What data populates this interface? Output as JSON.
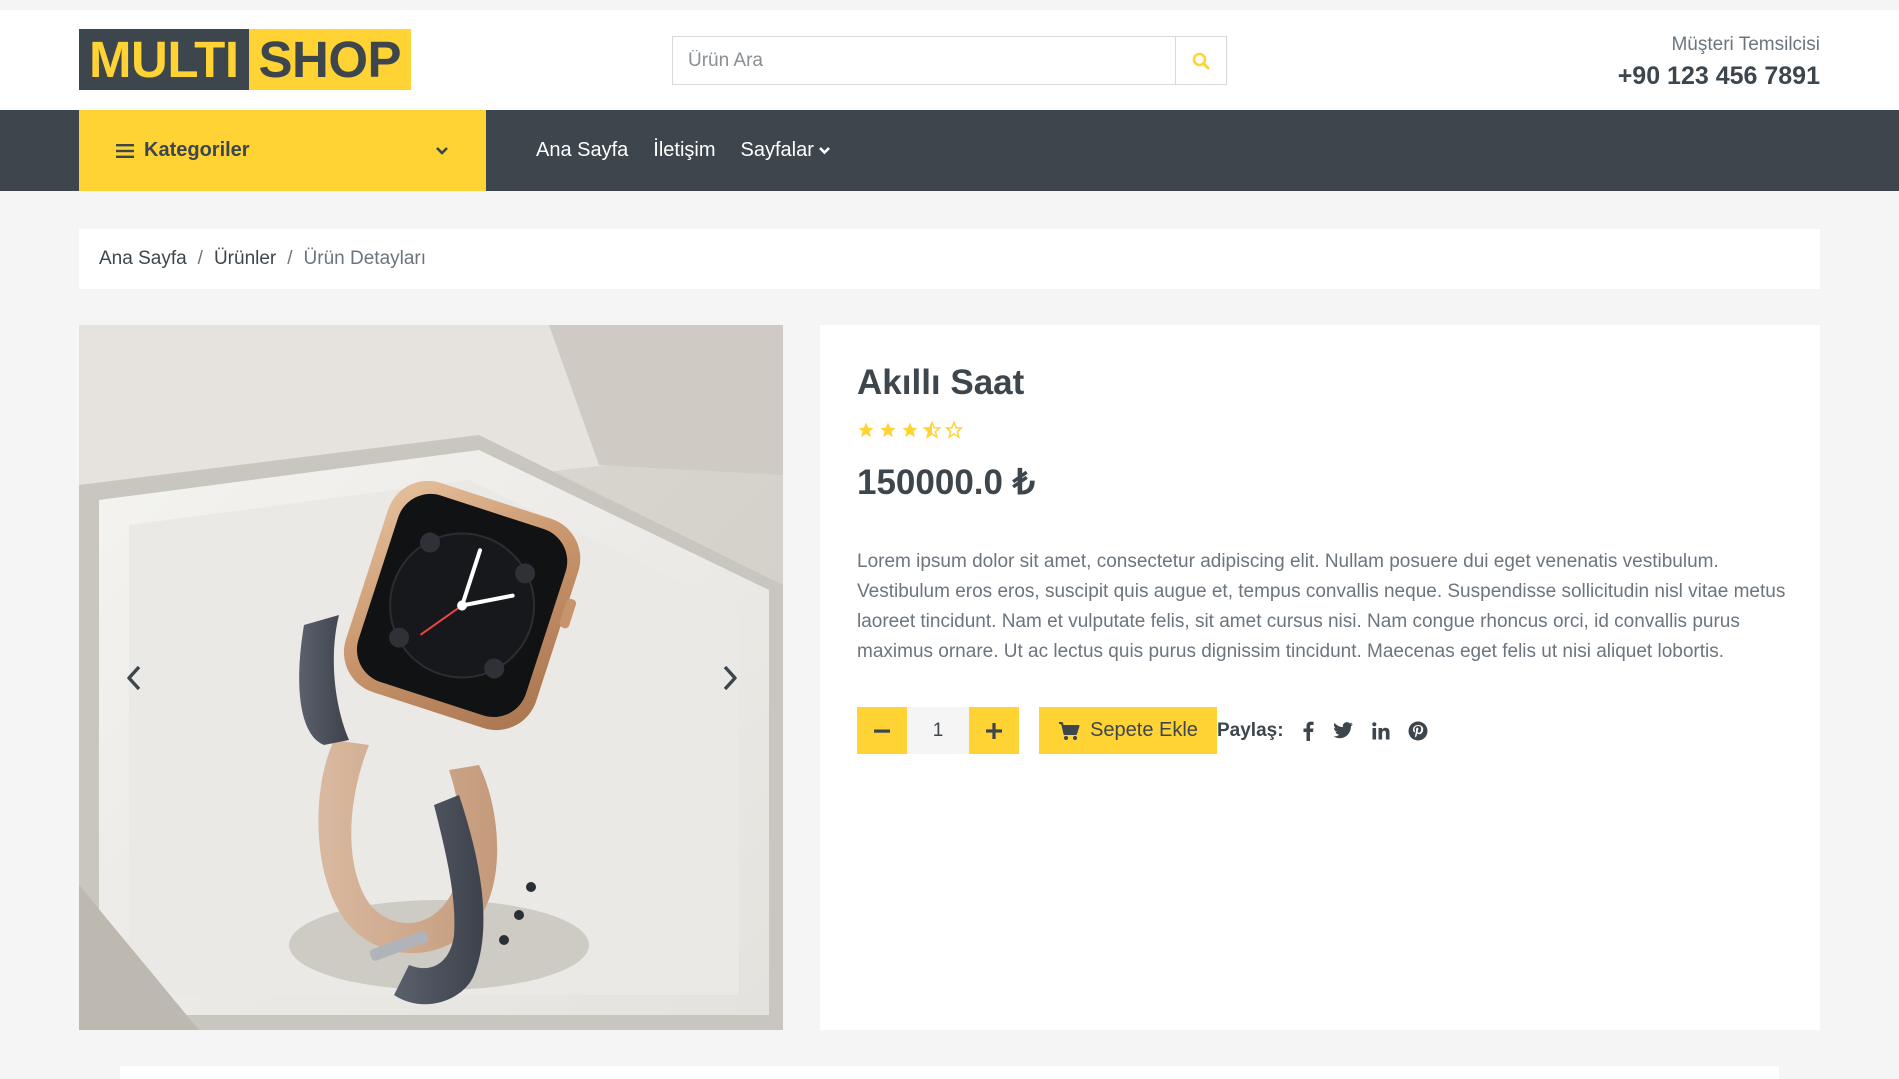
{
  "header": {
    "logo_part1": "MULTI",
    "logo_part2": "SHOP",
    "search_placeholder": "Ürün Ara",
    "contact_label": "Müşteri Temsilcisi",
    "contact_phone": "+90 123 456 7891"
  },
  "nav": {
    "categories_label": "Kategoriler",
    "links": [
      {
        "label": "Ana Sayfa"
      },
      {
        "label": "İletişim"
      },
      {
        "label": "Sayfalar"
      }
    ]
  },
  "breadcrumb": {
    "items": [
      "Ana Sayfa",
      "Ürünler",
      "Ürün Detayları"
    ],
    "separator": "/"
  },
  "product": {
    "title": "Akıllı Saat",
    "rating": 3.5,
    "rating_max": 5,
    "price": "150000.0 ₺",
    "description": "Lorem ipsum dolor sit amet, consectetur adipiscing elit. Nullam posuere dui eget venenatis vestibulum. Vestibulum eros eros, suscipit quis augue et, tempus convallis neque. Suspendisse sollicitudin nisl vitae metus laoreet tincidunt. Nam et vulputate felis, sit amet cursus nisi. Nam congue rhoncus orci, id convallis purus maximus ornare. Ut ac lectus quis purus dignissim tincidunt. Maecenas eget felis ut nisi aliquet lobortis.",
    "quantity": "1",
    "add_to_cart": "Sepete Ekle",
    "share_label": "Paylaş:",
    "share_icons": [
      "facebook-icon",
      "twitter-icon",
      "linkedin-icon",
      "pinterest-icon"
    ]
  },
  "colors": {
    "accent": "#ffd333",
    "dark": "#3d464d",
    "muted": "#6c757d",
    "background": "#f5f5f5"
  }
}
